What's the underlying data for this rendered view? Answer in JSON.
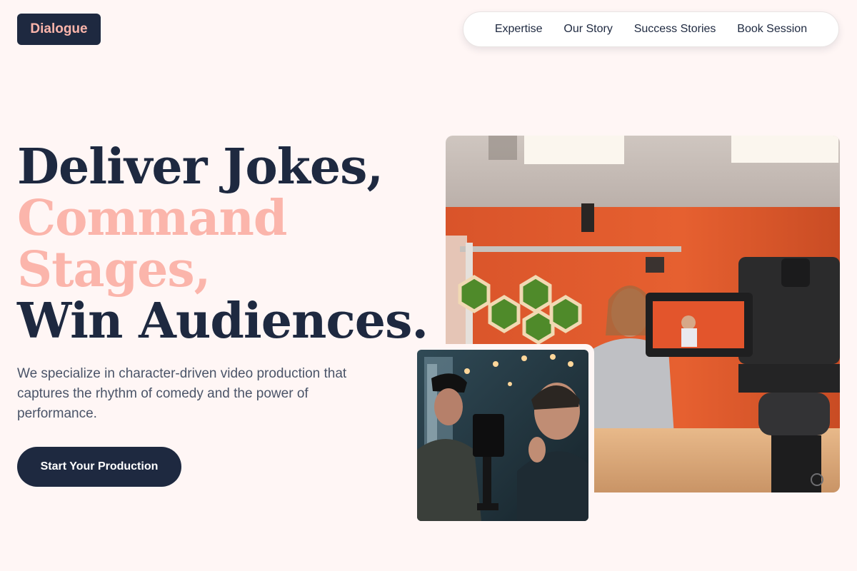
{
  "brand": {
    "logo_text": "Dialogue"
  },
  "nav": {
    "items": [
      {
        "label": "Expertise"
      },
      {
        "label": "Our Story"
      },
      {
        "label": "Success Stories"
      },
      {
        "label": "Book Session"
      }
    ]
  },
  "hero": {
    "headline": {
      "line1": "Deliver Jokes,",
      "line2": "Command",
      "line3": "Stages,",
      "line4": "Win Audiences."
    },
    "lead": "We specialize in character-driven video production that captures the rhythm of comedy and the power of performance.",
    "cta_label": "Start Your Production"
  },
  "images": {
    "main": {
      "subject": "camera-recording-presenter-in-studio"
    },
    "secondary": {
      "subject": "videographers-with-gimbal-camera"
    }
  },
  "colors": {
    "navy": "#1e2940",
    "pink": "#fbb5ab",
    "background": "#fff6f5",
    "studio_wall": "#e2562a"
  }
}
